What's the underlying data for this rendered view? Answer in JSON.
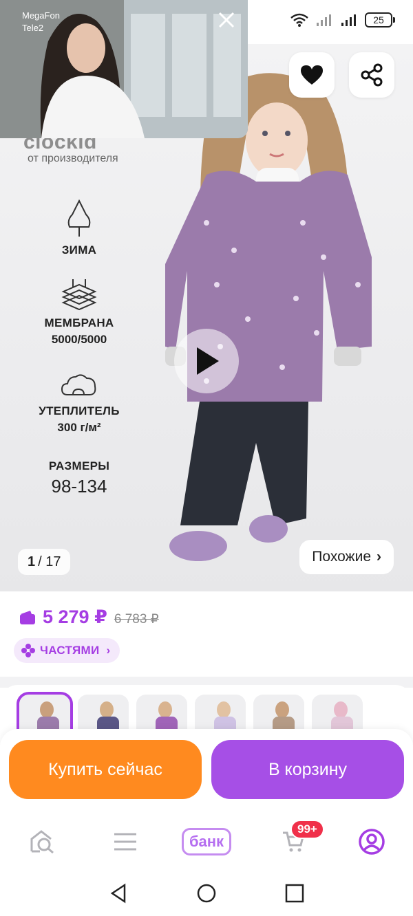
{
  "status_bar": {
    "carrier_1": "MegaFon",
    "carrier_2": "Tele2",
    "battery": "25"
  },
  "video_pip": {
    "close_icon": "close-icon"
  },
  "gallery": {
    "brand_logo": "clockid",
    "brand_sub": "от производителя",
    "features": [
      {
        "label": "ЗИМА",
        "icon": "tree-icon"
      },
      {
        "label": "МЕМБРАНА",
        "value": "5000/5000",
        "icon": "membrane-icon"
      },
      {
        "label": "УТЕПЛИТЕЛЬ",
        "value": "300 г/м²",
        "icon": "cloud-icon"
      },
      {
        "label": "РАЗМЕРЫ",
        "value": "98-134"
      }
    ],
    "counter_current": "1",
    "counter_total": "/ 17",
    "similar_label": "Похожие",
    "similar_chevron": "›"
  },
  "price": {
    "current": "5 279 ₽",
    "old": "6 783 ₽",
    "installments_label": "ЧАСТЯМИ",
    "installments_chevron": "›"
  },
  "actions": {
    "buy_now": "Купить сейчас",
    "add_to_cart": "В корзину"
  },
  "bottom_nav": {
    "bank_label": "банк",
    "cart_count": "99+"
  },
  "colors": {
    "accent": "#a53de3",
    "buy_button": "#ff8a1f",
    "cart_button": "#a64fe6",
    "badge": "#f0304a"
  }
}
